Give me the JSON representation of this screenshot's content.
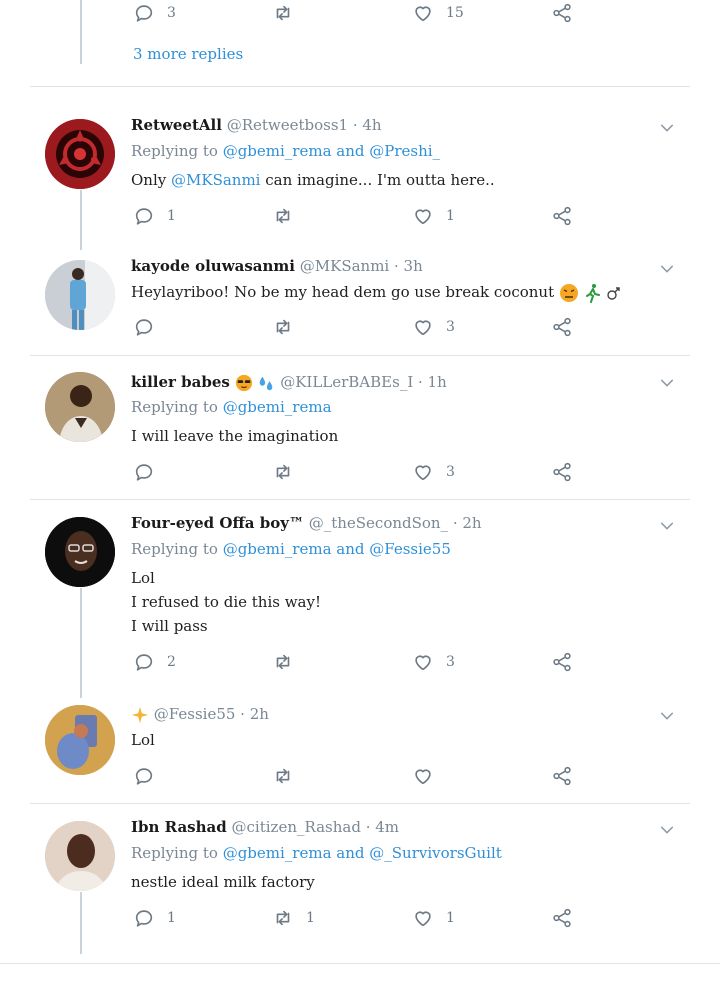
{
  "top_thread": {
    "reply_count": "3",
    "like_count": "15",
    "more_replies": "3 more replies"
  },
  "tweets": [
    {
      "name": "RetweetAll",
      "handle": "@Retweetboss1 · 4h",
      "replying_prefix": "Replying to ",
      "replying_to": "@gbemi_rema and @Preshi_",
      "text_lines": [
        "Only ",
        "@MKSanmi",
        " can imagine... I'm outta here.."
      ],
      "reply_count": "1",
      "retweet_count": "",
      "like_count": "1"
    },
    {
      "name": "kayode oluwasanmi",
      "handle": "@MKSanmi · 3h",
      "text": "Heylayriboo! No be my head dem go use break coconut",
      "reply_count": "",
      "retweet_count": "",
      "like_count": "3"
    },
    {
      "name": "killer babes",
      "handle": "@KILLerBABEs_I · 1h",
      "replying_prefix": "Replying to ",
      "replying_to": "@gbemi_rema",
      "text": "I will leave the imagination",
      "reply_count": "",
      "retweet_count": "",
      "like_count": "3"
    },
    {
      "name": "Four-eyed Offa boy™",
      "handle": "@_theSecondSon_ · 2h",
      "replying_prefix": "Replying to ",
      "replying_to": "@gbemi_rema and @Fessie55",
      "text_1": "Lol",
      "text_2": "I refused to die this way!",
      "text_3": "I will pass",
      "reply_count": "2",
      "retweet_count": "",
      "like_count": "3"
    },
    {
      "name": "",
      "handle": "@Fessie55 · 2h",
      "text": "Lol",
      "reply_count": "",
      "retweet_count": "",
      "like_count": ""
    },
    {
      "name": "Ibn Rashad",
      "handle": "@citizen_Rashad · 4m",
      "replying_prefix": "Replying to ",
      "replying_to": "@gbemi_rema and @_SurvivorsGuilt",
      "text": "nestle ideal milk factory",
      "reply_count": "1",
      "retweet_count": "1",
      "like_count": "1"
    }
  ],
  "colors": {
    "link": "#2f90d8",
    "muted": "#7a8794",
    "divider": "#dde3e8",
    "thread_line": "#c9d3dc"
  },
  "icons": [
    "reply-icon",
    "retweet-icon",
    "like-icon",
    "share-icon",
    "chevron-down-icon"
  ]
}
